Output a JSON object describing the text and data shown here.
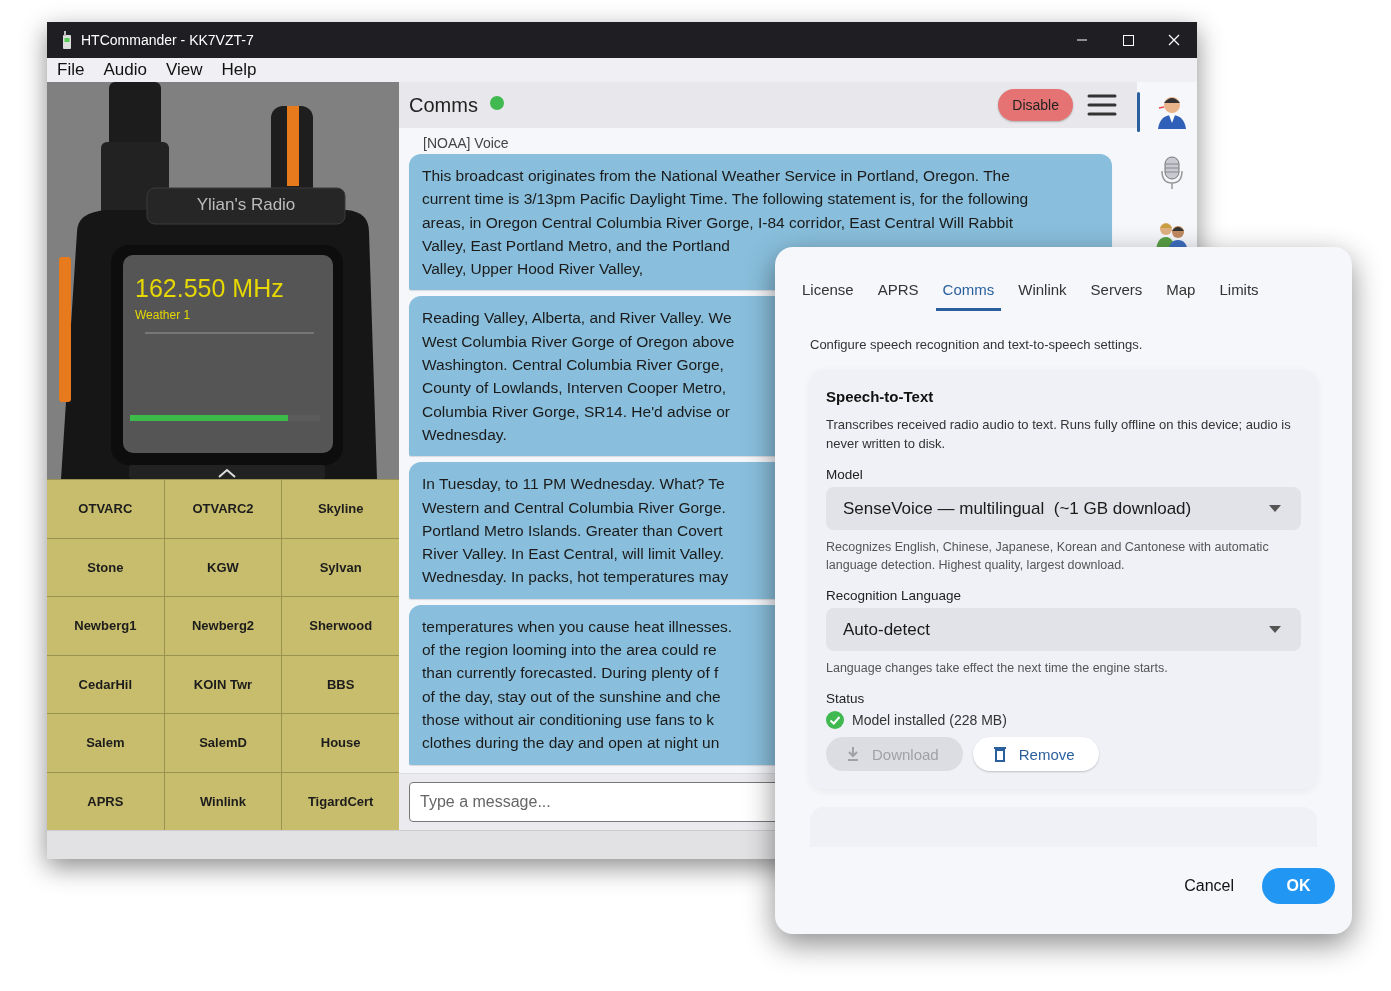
{
  "window": {
    "title": "HTCommander - KK7VZT-7",
    "menu": [
      "File",
      "Audio",
      "View",
      "Help"
    ]
  },
  "radio": {
    "name": "Ylian's Radio",
    "frequency": "162.550 MHz",
    "channel": "Weather 1",
    "level": 0.83
  },
  "channel_buttons": [
    "OTVARC",
    "OTVARC2",
    "Skyline",
    "Stone",
    "KGW",
    "Sylvan",
    "Newberg1",
    "Newberg2",
    "Sherwood",
    "CedarHil",
    "KOIN Twr",
    "BBS",
    "Salem",
    "SalemD",
    "House",
    "APRS",
    "Winlink",
    "TigardCert"
  ],
  "comms": {
    "title": "Comms",
    "connected": true,
    "disable_button": "Disable",
    "sender": "[NOAA] Voice",
    "messages": [
      {
        "lines": [
          "This broadcast originates from the National Weather Service in Portland, Oregon. The",
          "current time is 3/13pm Pacific Daylight Time. The following statement is, for the following",
          "areas, in Oregon Central Columbia River Gorge, I-84 corridor, East Central Will Rabbit",
          "Valley, East Portland Metro, and the Portland",
          "Valley, Upper Hood River Valley,"
        ]
      },
      {
        "lines": [
          "Reading Valley, Alberta, and River Valley. We",
          "West Columbia River Gorge of Oregon above",
          "Washington. Central Columbia River Gorge,",
          "County of Lowlands, Interven Cooper Metro,",
          "Columbia River Gorge, SR14. He'd advise or",
          "Wednesday."
        ]
      },
      {
        "lines": [
          "In Tuesday, to 11 PM Wednesday. What? Te",
          "Western and Central Columbia River Gorge.",
          "Portland Metro Islands. Greater than Covert",
          "River Valley. In East Central, will limit Valley.",
          "Wednesday. In packs, hot temperatures may"
        ]
      },
      {
        "lines": [
          "temperatures when you cause heat illnesses.",
          "of the region looming into the area could re",
          "than currently forecasted. During plenty of f",
          "of the day, stay out of the sunshine and che",
          "those without air conditioning use fans to k",
          "clothes during the day and open at night un"
        ]
      }
    ],
    "input": {
      "placeholder": "Type a message..."
    }
  },
  "sidebar": {
    "items": [
      {
        "selected": true
      },
      {
        "selected": false
      },
      {
        "selected": false
      }
    ]
  },
  "dialog": {
    "tabs": [
      {
        "label": "License",
        "selected": false
      },
      {
        "label": "APRS",
        "selected": false
      },
      {
        "label": "Comms",
        "selected": true
      },
      {
        "label": "Winlink",
        "selected": false
      },
      {
        "label": "Servers",
        "selected": false
      },
      {
        "label": "Map",
        "selected": false
      },
      {
        "label": "Limits",
        "selected": false
      }
    ],
    "description": "Configure speech recognition and text-to-speech settings.",
    "section": {
      "title": "Speech-to-Text",
      "description": "Transcribes received radio audio to text. Runs fully offline on this device; audio is never written to disk.",
      "fields": [
        {
          "label": "Model",
          "value": "SenseVoice — multilingual  (~1 GB download)",
          "help": "Recognizes English, Chinese, Japanese, Korean and Cantonese with automatic language detection. Highest quality, largest download."
        },
        {
          "label": "Recognition Language",
          "value": "Auto-detect",
          "help": "Language changes take effect the next time the engine starts."
        }
      ],
      "status": {
        "label": "Status",
        "installed": true,
        "text": "Model installed (228 MB)"
      },
      "buttons": [
        {
          "label": "Download",
          "kind": "download",
          "disabled": true
        },
        {
          "label": "Remove",
          "kind": "remove",
          "disabled": false
        }
      ]
    },
    "buttons": [
      {
        "label": "Cancel",
        "kind": "text"
      },
      {
        "label": "OK",
        "kind": "primary"
      }
    ]
  }
}
